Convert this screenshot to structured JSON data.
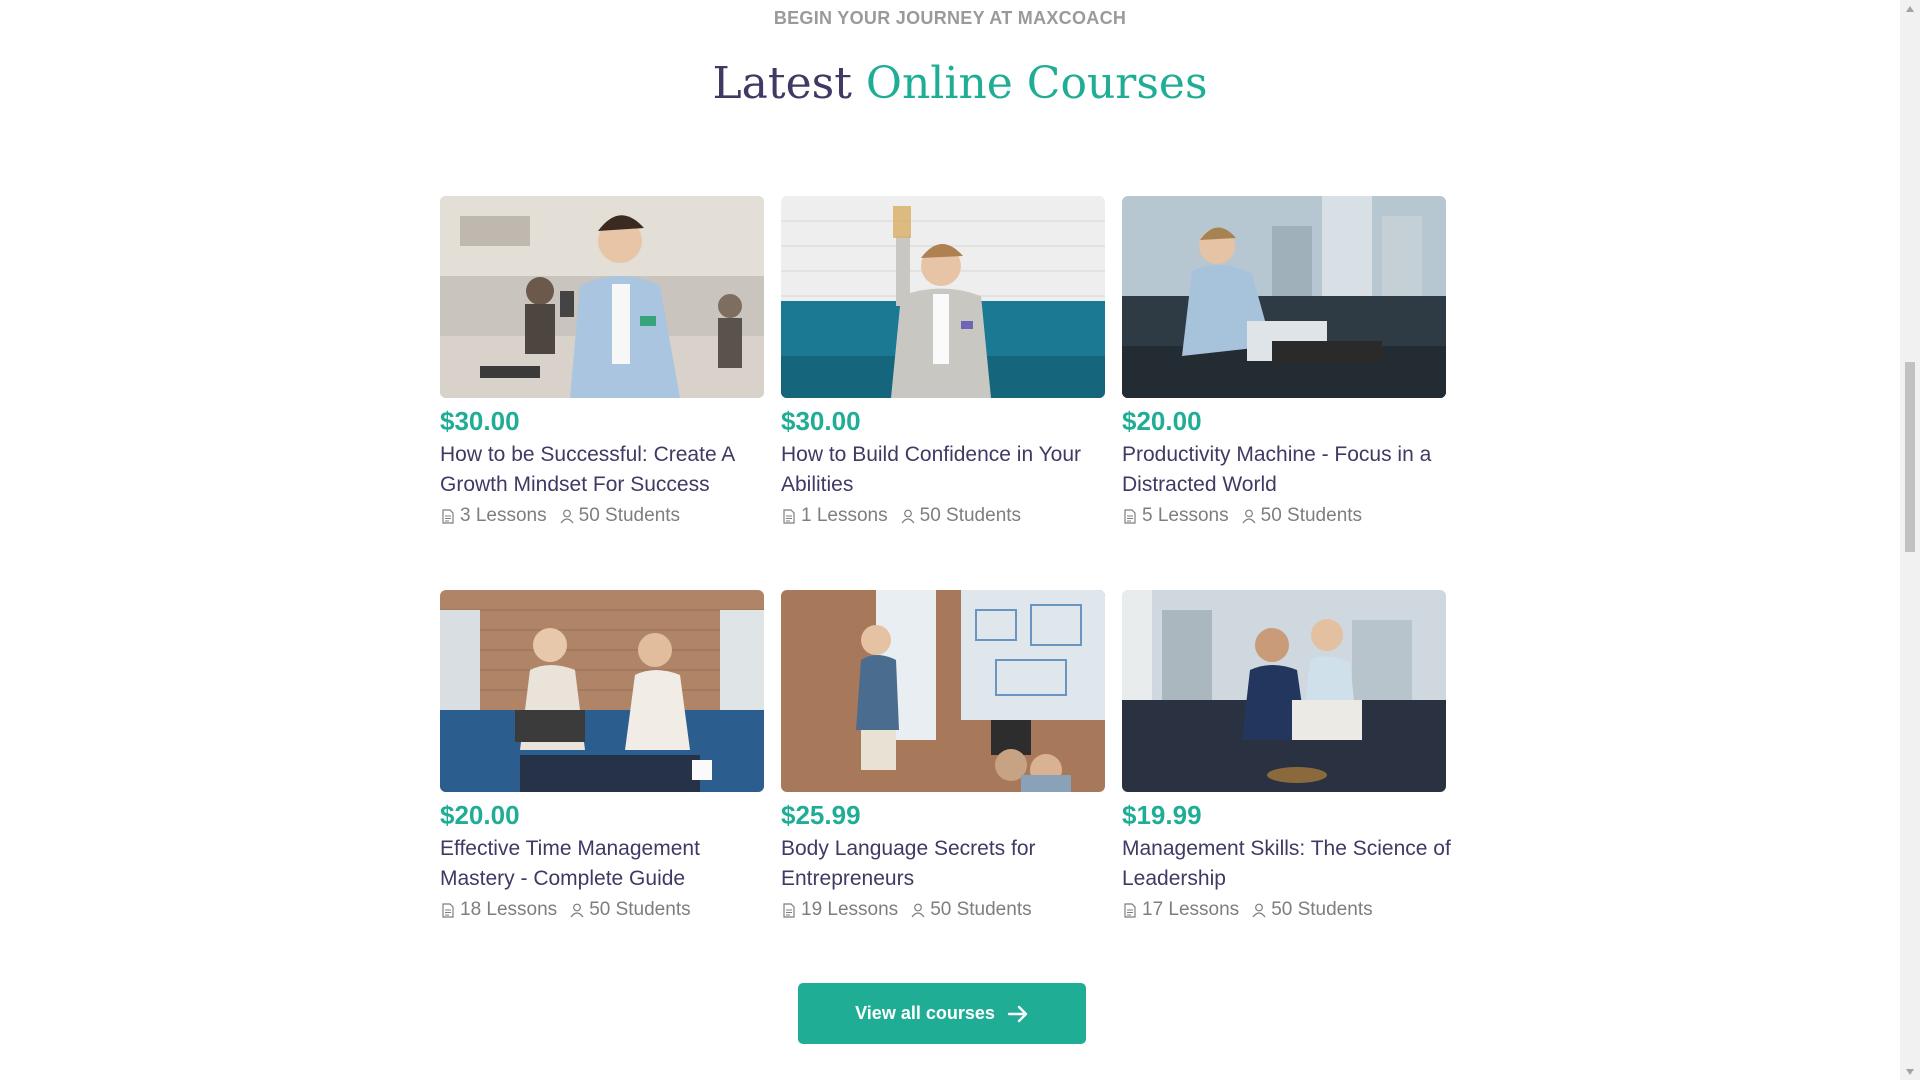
{
  "section": {
    "eyebrow": "BEGIN YOUR JOURNEY AT MAXCOACH",
    "title_part1": "Latest",
    "title_part2": "Online Courses"
  },
  "courses": [
    {
      "price": "$30.00",
      "title": "How to be Successful: Create A Growth Mindset For Success",
      "lessons": "3 Lessons",
      "students": "50 Students"
    },
    {
      "price": "$30.00",
      "title": "How to Build Confidence in Your Abilities",
      "lessons": "1 Lessons",
      "students": "50 Students"
    },
    {
      "price": "$20.00",
      "title": "Productivity Machine - Focus in a Distracted World",
      "lessons": "5 Lessons",
      "students": "50 Students"
    },
    {
      "price": "$20.00",
      "title": "Effective Time Management Mastery - Complete Guide",
      "lessons": "18 Lessons",
      "students": "50 Students"
    },
    {
      "price": "$25.99",
      "title": "Body Language Secrets for Entrepreneurs",
      "lessons": "19 Lessons",
      "students": "50 Students"
    },
    {
      "price": "$19.99",
      "title": "Management Skills: The Science of Leadership",
      "lessons": "17 Lessons",
      "students": "50 Students"
    }
  ],
  "cta": {
    "label": "View all courses",
    "icon": "arrow-right-icon"
  },
  "colors": {
    "accent": "#20ad96",
    "heading": "#3f3a64",
    "muted": "#9a9a9a",
    "meta": "#7e7e7e"
  }
}
